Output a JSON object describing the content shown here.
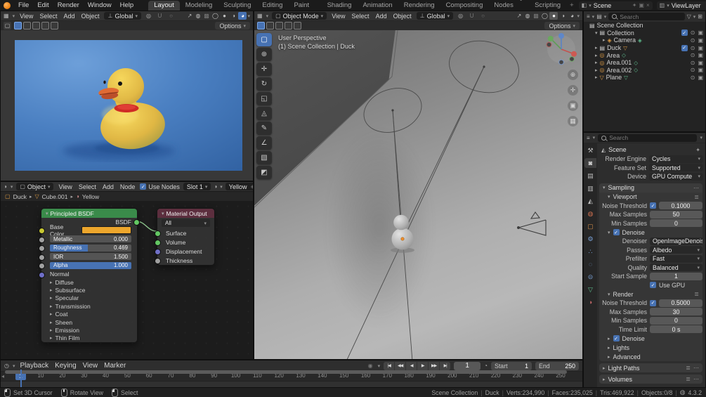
{
  "topbar": {
    "menus": [
      "File",
      "Edit",
      "Render",
      "Window",
      "Help"
    ],
    "tabs": [
      "Layout",
      "Modeling",
      "Sculpting",
      "UV Editing",
      "Texture Paint",
      "Shading",
      "Animation",
      "Rendering",
      "Compositing",
      "Geometry Nodes",
      "Scripting"
    ],
    "active_tab": "Layout",
    "new_tab": "+",
    "scene": {
      "label": "Scene"
    },
    "view_layer": {
      "label": "ViewLayer"
    }
  },
  "camera_viewport": {
    "menus": [
      "View",
      "Select",
      "Add",
      "Object"
    ],
    "orientation": "Global",
    "options": "Options",
    "shading_active": 3
  },
  "viewport": {
    "mode": "Object Mode",
    "menus": [
      "View",
      "Select",
      "Add",
      "Object"
    ],
    "orientation": "Global",
    "options": "Options",
    "shading_active": 1,
    "overlay": [
      "User Perspective",
      "(1) Scene Collection | Duck"
    ],
    "toolbar": [
      {
        "name": "select-box-tool",
        "glyph": "▢",
        "active": true
      },
      {
        "name": "cursor-tool",
        "glyph": "⊕"
      },
      {
        "name": "move-tool",
        "glyph": "✛"
      },
      {
        "name": "rotate-tool",
        "glyph": "↻"
      },
      {
        "name": "scale-tool",
        "glyph": "◱"
      },
      {
        "name": "transform-tool",
        "glyph": "◬"
      },
      {
        "name": "annotate-tool",
        "glyph": "✎"
      },
      {
        "name": "measure-tool",
        "glyph": "∠"
      },
      {
        "name": "add-cube-tool",
        "glyph": "▧"
      },
      {
        "name": "mesh-extra-tool",
        "glyph": "◩"
      }
    ],
    "nav_icons": [
      {
        "name": "zoom-icon",
        "glyph": "⊕"
      },
      {
        "name": "pan-icon",
        "glyph": "✛"
      },
      {
        "name": "camera-view-icon",
        "glyph": "▣"
      },
      {
        "name": "grid-ortho-icon",
        "glyph": "▦"
      }
    ]
  },
  "shader": {
    "shader_type": "Object",
    "menus": [
      "View",
      "Select",
      "Add",
      "Node"
    ],
    "use_nodes": "Use Nodes",
    "slot": "Slot 1",
    "material": "Yellow",
    "breadcrumb": [
      {
        "label": "Duck",
        "icon": "object-icon",
        "glyph": "▢",
        "color": "#dd9b44"
      },
      {
        "label": "Cube.001",
        "icon": "mesh-icon",
        "glyph": "▽",
        "color": "#dd9b44"
      },
      {
        "label": "Yellow",
        "icon": "material-icon",
        "glyph": "◑",
        "color": "#cf8d8d"
      }
    ],
    "principled": {
      "title": "Principled BSDF",
      "output": "BSDF",
      "base_color_label": "Base Color",
      "sliders": [
        {
          "label": "Metallic",
          "value": "0.000",
          "fill": 0
        },
        {
          "label": "Roughness",
          "value": "0.469",
          "fill": 0.469
        },
        {
          "label": "IOR",
          "value": "1.500",
          "fill": 0
        },
        {
          "label": "Alpha",
          "value": "1.000",
          "fill": 1
        }
      ],
      "normal": "Normal",
      "collapsed": [
        "Diffuse",
        "Subsurface",
        "Specular",
        "Transmission",
        "Coat",
        "Sheen",
        "Emission",
        "Thin Film"
      ]
    },
    "output_node": {
      "title": "Material Output",
      "target": "All",
      "inputs": [
        {
          "label": "Surface",
          "socket": "#63c763"
        },
        {
          "label": "Volume",
          "socket": "#63c763"
        },
        {
          "label": "Displacement",
          "socket": "#7070c7"
        },
        {
          "label": "Thickness",
          "socket": "#a0a0a0"
        }
      ]
    }
  },
  "outliner": {
    "search_placeholder": "Search",
    "rows": [
      {
        "label": "Scene Collection",
        "depth": 0,
        "icon": "collection",
        "chev": "",
        "check": false,
        "eye": false,
        "cam": false,
        "badge": ""
      },
      {
        "label": "Collection",
        "depth": 1,
        "icon": "collection",
        "chev": "▾",
        "check": true,
        "eye": true,
        "cam": true,
        "badge": ""
      },
      {
        "label": "Camera",
        "depth": 2,
        "icon": "camera_obj",
        "chev": "▸",
        "check": false,
        "eye": true,
        "cam": true,
        "badge": "badge_camera"
      },
      {
        "label": "Duck",
        "depth": 1,
        "icon": "collection",
        "chev": "▸",
        "check": true,
        "eye": true,
        "cam": true,
        "badge": "badge_mesh_orange"
      },
      {
        "label": "Area",
        "depth": 1,
        "icon": "light",
        "chev": "▸",
        "check": false,
        "eye": true,
        "cam": true,
        "badge": "badge_light"
      },
      {
        "label": "Area.001",
        "depth": 1,
        "icon": "light",
        "chev": "▸",
        "check": false,
        "eye": true,
        "cam": true,
        "badge": "badge_light"
      },
      {
        "label": "Area.002",
        "depth": 1,
        "icon": "light",
        "chev": "▸",
        "check": false,
        "eye": true,
        "cam": true,
        "badge": "badge_light"
      },
      {
        "label": "Plane",
        "depth": 1,
        "icon": "mesh",
        "chev": "▸",
        "check": false,
        "eye": true,
        "cam": true,
        "badge": "badge_mesh_green"
      }
    ]
  },
  "properties": {
    "search_placeholder": "Search",
    "context": "Scene",
    "tabs": [
      {
        "name": "tool-tab",
        "glyph": "⚒",
        "color": "#bdbdbd",
        "active": false
      },
      {
        "name": "render-tab",
        "glyph": "◙",
        "color": "#d5d5d5",
        "active": true
      },
      {
        "name": "output-tab",
        "glyph": "▤",
        "color": "#bdbdbd",
        "active": false
      },
      {
        "name": "view-layer-tab",
        "glyph": "▥",
        "color": "#bdbdbd",
        "active": false
      },
      {
        "name": "scene-tab",
        "glyph": "◭",
        "color": "#bdbdbd",
        "active": false
      },
      {
        "name": "world-tab",
        "glyph": "◍",
        "color": "#cf7050",
        "active": false
      },
      {
        "name": "object-tab",
        "glyph": "▢",
        "color": "#d9914a",
        "active": false
      },
      {
        "name": "modifiers-tab",
        "glyph": "⚙",
        "color": "#7aa2d8",
        "active": false
      },
      {
        "name": "particles-tab",
        "glyph": "∴",
        "color": "#7aa2d8",
        "active": false
      },
      {
        "name": "physics-tab",
        "glyph": "◌",
        "color": "#7aa2d8",
        "active": false
      },
      {
        "name": "constraints-tab",
        "glyph": "⊝",
        "color": "#7aa2d8",
        "active": false
      },
      {
        "name": "data-tab",
        "glyph": "▽",
        "color": "#5fbf8f",
        "active": false
      },
      {
        "name": "material-tab",
        "glyph": "◑",
        "color": "#c76a6a",
        "active": false
      }
    ],
    "fields": [
      {
        "label": "Render Engine",
        "value": "Cycles"
      },
      {
        "label": "Feature Set",
        "value": "Supported"
      },
      {
        "label": "Device",
        "value": "GPU Compute"
      }
    ],
    "sampling": {
      "title": "Sampling",
      "viewport": {
        "title": "Viewport",
        "rows": [
          {
            "label": "Noise Threshold",
            "value": "0.1000",
            "type": "val",
            "check": true
          },
          {
            "label": "Max Samples",
            "value": "50",
            "type": "val",
            "check": false
          },
          {
            "label": "Min Samples",
            "value": "0",
            "type": "val",
            "check": false
          }
        ],
        "denoise": {
          "title": "Denoise",
          "rows": [
            {
              "label": "Denoiser",
              "value": "OpenImageDenoise",
              "type": "drop",
              "check": false
            },
            {
              "label": "Passes",
              "value": "Albedo",
              "type": "drop",
              "check": false
            },
            {
              "label": "Prefilter",
              "value": "Fast",
              "type": "drop",
              "check": false
            },
            {
              "label": "Quality",
              "value": "Balanced",
              "type": "drop",
              "check": false
            },
            {
              "label": "Start Sample",
              "value": "1",
              "type": "val",
              "check": false
            }
          ],
          "use_gpu": "Use GPU"
        }
      },
      "render": {
        "title": "Render",
        "rows": [
          {
            "label": "Noise Threshold",
            "value": "0.5000",
            "type": "val",
            "check": true
          },
          {
            "label": "Max Samples",
            "value": "30",
            "type": "val",
            "check": false
          },
          {
            "label": "Min Samples",
            "value": "0",
            "type": "val",
            "check": false
          },
          {
            "label": "Time Limit",
            "value": "0 s",
            "type": "val",
            "check": false
          }
        ],
        "denoise_collapsed": "Denoise"
      },
      "collapsed": [
        "Lights",
        "Advanced"
      ]
    },
    "panels": [
      "Light Paths",
      "Volumes"
    ]
  },
  "timeline": {
    "menus": [
      "Playback",
      "Keying",
      "View",
      "Marker"
    ],
    "playback": [
      {
        "name": "jump-to-start",
        "glyph": "|◀"
      },
      {
        "name": "prev-keyframe",
        "glyph": "◀◀"
      },
      {
        "name": "play-reverse",
        "glyph": "◀"
      },
      {
        "name": "play",
        "glyph": "▶"
      },
      {
        "name": "next-keyframe",
        "glyph": "▶▶"
      },
      {
        "name": "jump-to-end",
        "glyph": "▶|"
      }
    ],
    "current_frame": "1",
    "start_label": "Start",
    "start": "1",
    "end_label": "End",
    "end": "250",
    "first_frame": "1",
    "ticks": [
      10,
      20,
      30,
      40,
      50,
      60,
      70,
      80,
      90,
      100,
      110,
      120,
      130,
      140,
      150,
      160,
      170,
      180,
      190,
      200,
      210,
      220,
      230,
      240,
      250
    ]
  },
  "statusbar": {
    "hints": [
      {
        "button": "lmb",
        "label": "Set 3D Cursor"
      },
      {
        "button": "mmb",
        "label": "Rotate View"
      },
      {
        "button": "lmb",
        "label": "Select"
      }
    ],
    "stats": [
      "Scene Collection",
      "Duck",
      "Verts:234,990",
      "Faces:235,025",
      "Tris:469,922",
      "Objects:0/8"
    ],
    "version": "4.3.2"
  },
  "icons": {
    "shading": [
      "◯",
      "●",
      "◑",
      "◕"
    ],
    "shading_names": [
      "wireframe-shading-icon",
      "solid-shading-icon",
      "material-shading-icon",
      "rendered-shading-icon"
    ],
    "eye": "⊙",
    "camera_toggle": "▣",
    "check": "✓",
    "chev_r": "▸",
    "chev_d": "▾",
    "caret": "▾",
    "magnet": "U",
    "pivot": "◎",
    "orientation": "⊥",
    "overlays": "◍",
    "gizmo_arrow": "↗",
    "proportional": "○",
    "dots": "⋯",
    "list": "≣",
    "clock": "◷",
    "stopwatch": "◔",
    "record": "◉",
    "back_arrow": "◂",
    "network": "◍",
    "editor_3d": "▦",
    "editor_shader": "◑",
    "editor_outliner": "≡",
    "editor_props": "≡",
    "editor_timeline": "◷",
    "filter": "▽",
    "new_collection": "⊞",
    "display_mode": "▤",
    "pin": "✦",
    "duplicate": "▣",
    "unlink": "×",
    "collection": [
      "▤",
      "#d0d0d0"
    ],
    "mesh": [
      "▽",
      "#dd9b44"
    ],
    "light": [
      "◎",
      "#dd9b44"
    ],
    "camera_obj": [
      "◈",
      "#dd9b44"
    ],
    "badge_mesh_orange": [
      "▽",
      "#dd9b44"
    ],
    "badge_mesh_green": [
      "▽",
      "#5fbf8f"
    ],
    "badge_light": [
      "◇",
      "#5fbf8f"
    ],
    "badge_camera": [
      "◈",
      "#5fbf8f"
    ]
  },
  "colors": {
    "accent": "#4772b3",
    "principled_header": "#3a8b4a",
    "output_header": "#5c2e3e",
    "base_color": "#eda62c",
    "link": "#8fc98f"
  }
}
